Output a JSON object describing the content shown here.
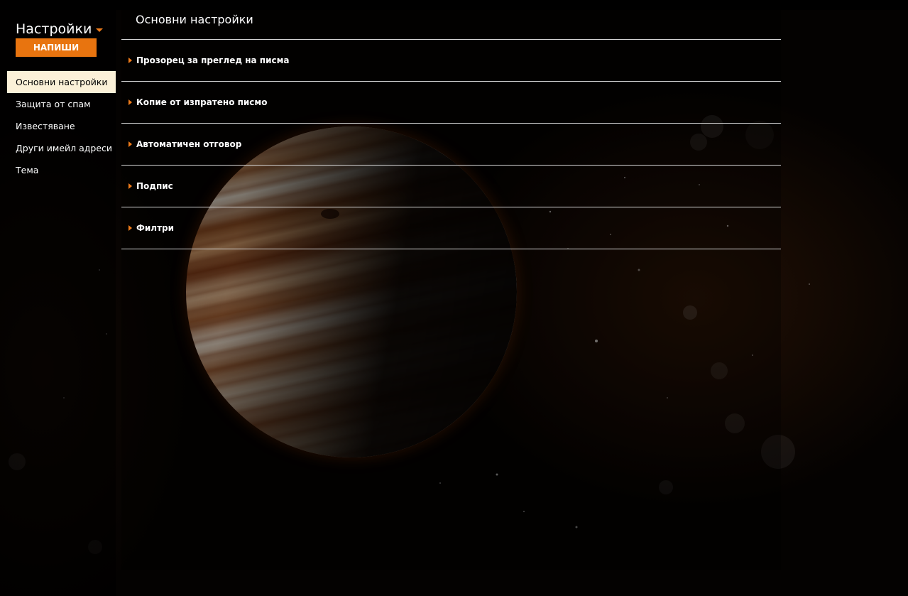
{
  "sidebar": {
    "title": "Настройки",
    "title_icon": "caret-down-icon",
    "compose_label": "НАПИШИ",
    "items": [
      {
        "label": "Основни настройки",
        "active": true
      },
      {
        "label": "Защита от спам",
        "active": false
      },
      {
        "label": "Известяване",
        "active": false
      },
      {
        "label": "Други имейл адреси",
        "active": false
      },
      {
        "label": "Тема",
        "active": false
      }
    ]
  },
  "main": {
    "title": "Основни настройки",
    "section_icon": "caret-right-icon",
    "sections": [
      {
        "label": "Прозорец за преглед на писма"
      },
      {
        "label": "Копие от изпратено писмо"
      },
      {
        "label": "Автоматичен отговор"
      },
      {
        "label": "Подпис"
      },
      {
        "label": "Филтри"
      }
    ]
  },
  "colors": {
    "accent": "#e8740f",
    "active_item_bg": "#fbf1d8",
    "divider": "#d8d8d8"
  }
}
